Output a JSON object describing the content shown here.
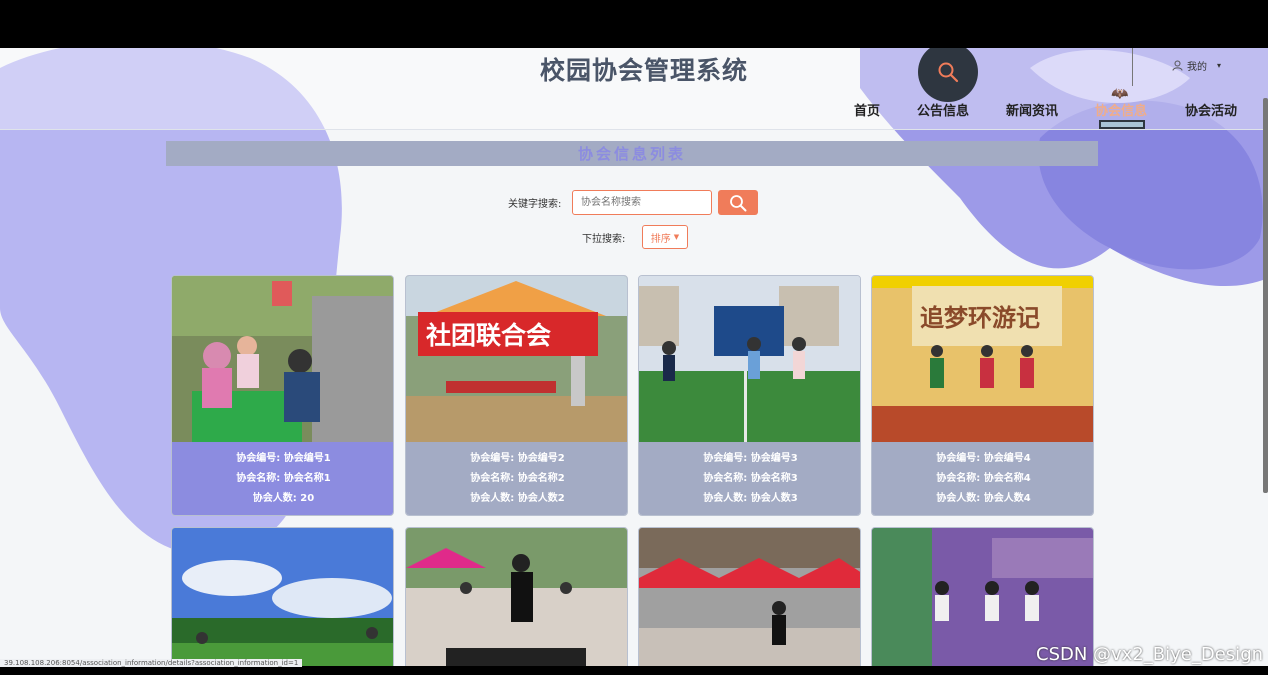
{
  "app": {
    "title": "校园协会管理系统"
  },
  "header": {
    "user_label": "我的",
    "nav": [
      {
        "label": "首页",
        "active": false
      },
      {
        "label": "公告信息",
        "active": false
      },
      {
        "label": "新闻资讯",
        "active": false
      },
      {
        "label": "协会信息",
        "active": true
      },
      {
        "label": "协会活动",
        "active": false
      }
    ]
  },
  "main": {
    "list_title": "协会信息列表",
    "search": {
      "label": "关键字搜索:",
      "placeholder": "协会名称搜索"
    },
    "filter": {
      "label": "下拉搜索:",
      "sort_label": "排序"
    }
  },
  "cards": [
    {
      "id_text": "协会编号: 协会编号1",
      "name_text": "协会名称: 协会名称1",
      "count_text": "协会人数: 20"
    },
    {
      "id_text": "协会编号: 协会编号2",
      "name_text": "协会名称: 协会名称2",
      "count_text": "协会人数: 协会人数2",
      "banner_text": "社团联合会"
    },
    {
      "id_text": "协会编号: 协会编号3",
      "name_text": "协会名称: 协会名称3",
      "count_text": "协会人数: 协会人数3"
    },
    {
      "id_text": "协会编号: 协会编号4",
      "name_text": "协会名称: 协会名称4",
      "count_text": "协会人数: 协会人数4",
      "banner_text": "追梦环游记"
    }
  ],
  "status_bar": {
    "url": "39.108.108.206:8054/association_information/details?association_information_id=1"
  },
  "watermark": "CSDN @vx2_Biye_Design",
  "colors": {
    "accent": "#f07c5a",
    "purple": "#8c8ce0",
    "gray_blue": "#a3abc4",
    "dark": "#2e3640"
  }
}
